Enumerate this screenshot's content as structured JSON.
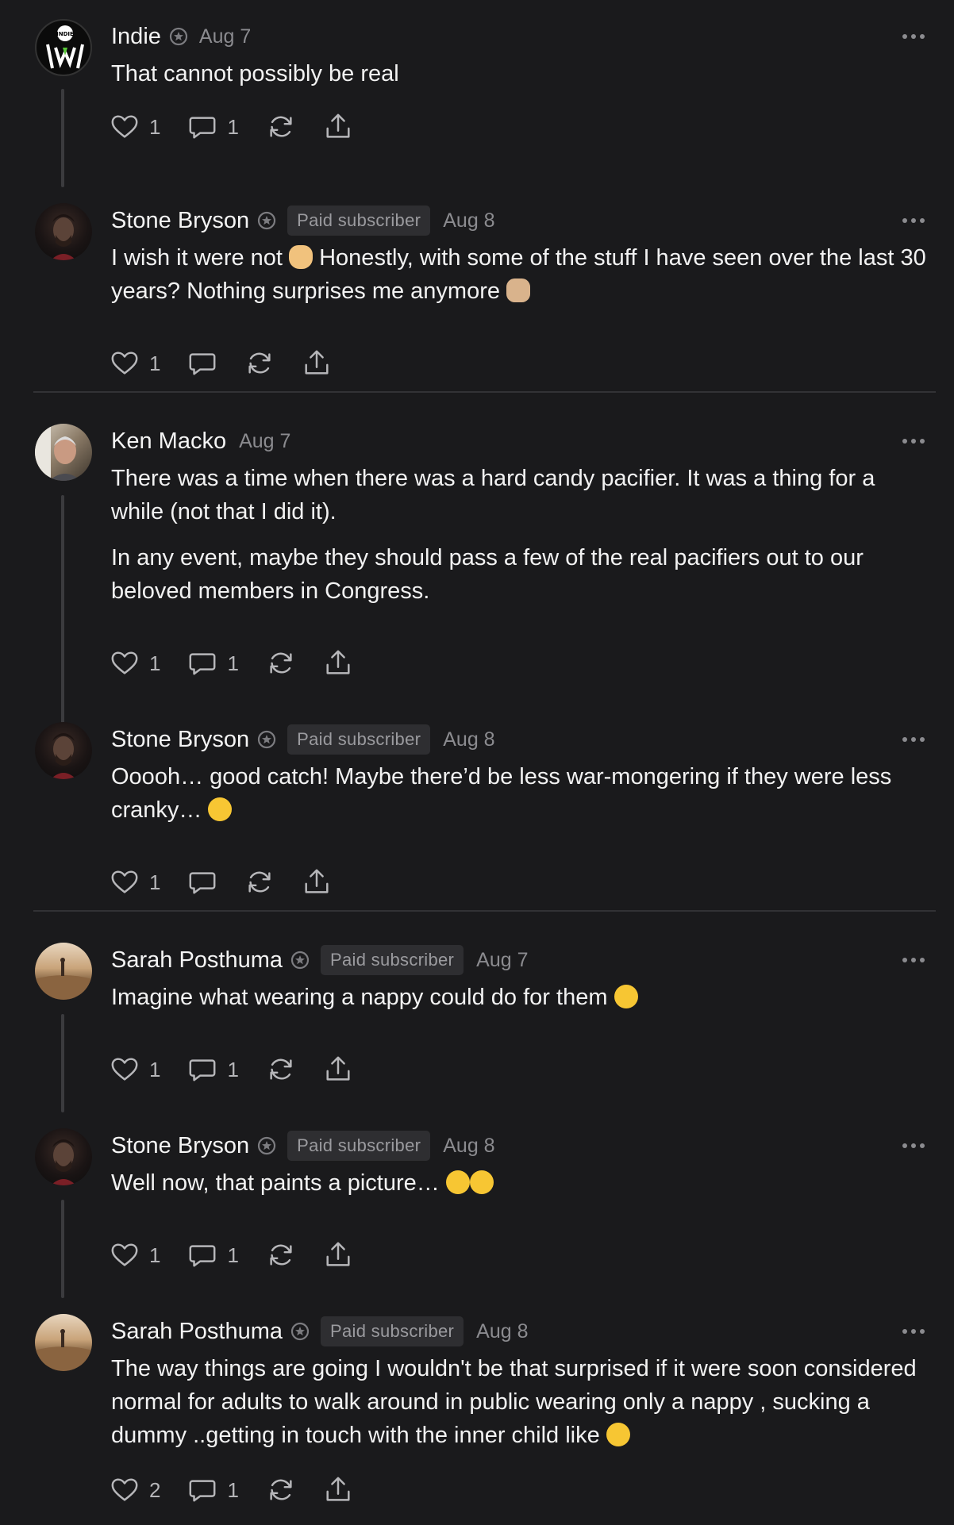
{
  "colors": {
    "background": "#1a1a1c",
    "text": "#f2f2f2",
    "muted": "#8b8b8f",
    "badge_bg": "#2e2e31"
  },
  "comments": [
    {
      "author": "Indie",
      "badge": "",
      "date": "Aug 7",
      "avatar_label": "INDIE",
      "paragraphs": [
        "That cannot possibly be real"
      ],
      "likes": "1",
      "replies": "1"
    },
    {
      "author": "Stone Bryson",
      "badge": "Paid subscriber",
      "date": "Aug 8",
      "paragraphs": [
        "I wish it were not",
        "Honestly, with some of the stuff I have seen over the last 30 years? Nothing surprises me anymore"
      ],
      "emojis": [
        "facepalm-emoji",
        "shrug-emoji"
      ],
      "likes": "1",
      "replies": ""
    },
    {
      "author": "Ken Macko",
      "badge": "",
      "date": "Aug 7",
      "paragraphs": [
        "There was a time when there was a hard candy pacifier. It was a thing for a while (not that I did it).",
        "In any event, maybe they should pass a few of the real pacifiers out to our beloved members in Congress."
      ],
      "likes": "1",
      "replies": "1"
    },
    {
      "author": "Stone Bryson",
      "badge": "Paid subscriber",
      "date": "Aug 8",
      "paragraphs": [
        "Ooooh… good catch! Maybe there’d be less war-mongering if they were less cranky…"
      ],
      "emojis": [
        "wink-emoji"
      ],
      "likes": "1",
      "replies": ""
    },
    {
      "author": "Sarah Posthuma",
      "badge": "Paid subscriber",
      "date": "Aug 7",
      "paragraphs": [
        "Imagine what wearing a nappy could do for them"
      ],
      "emojis": [
        "rofl-emoji"
      ],
      "likes": "1",
      "replies": "1"
    },
    {
      "author": "Stone Bryson",
      "badge": "Paid subscriber",
      "date": "Aug 8",
      "paragraphs": [
        "Well now, that paints a picture…"
      ],
      "emojis": [
        "flushed-emoji",
        "joy-emoji"
      ],
      "likes": "1",
      "replies": "1"
    },
    {
      "author": "Sarah Posthuma",
      "badge": "Paid subscriber",
      "date": "Aug 8",
      "paragraphs": [
        "The way things are going I wouldn't be that surprised if it were soon considered normal for adults to walk around in public wearing only a nappy , sucking a dummy ..getting in touch with the inner child like"
      ],
      "emojis": [
        "scream-emoji"
      ],
      "likes": "2",
      "replies": "1"
    }
  ],
  "icons": [
    "heart-icon",
    "comment-icon",
    "restack-icon",
    "share-icon",
    "more-icon",
    "verified-icon"
  ]
}
